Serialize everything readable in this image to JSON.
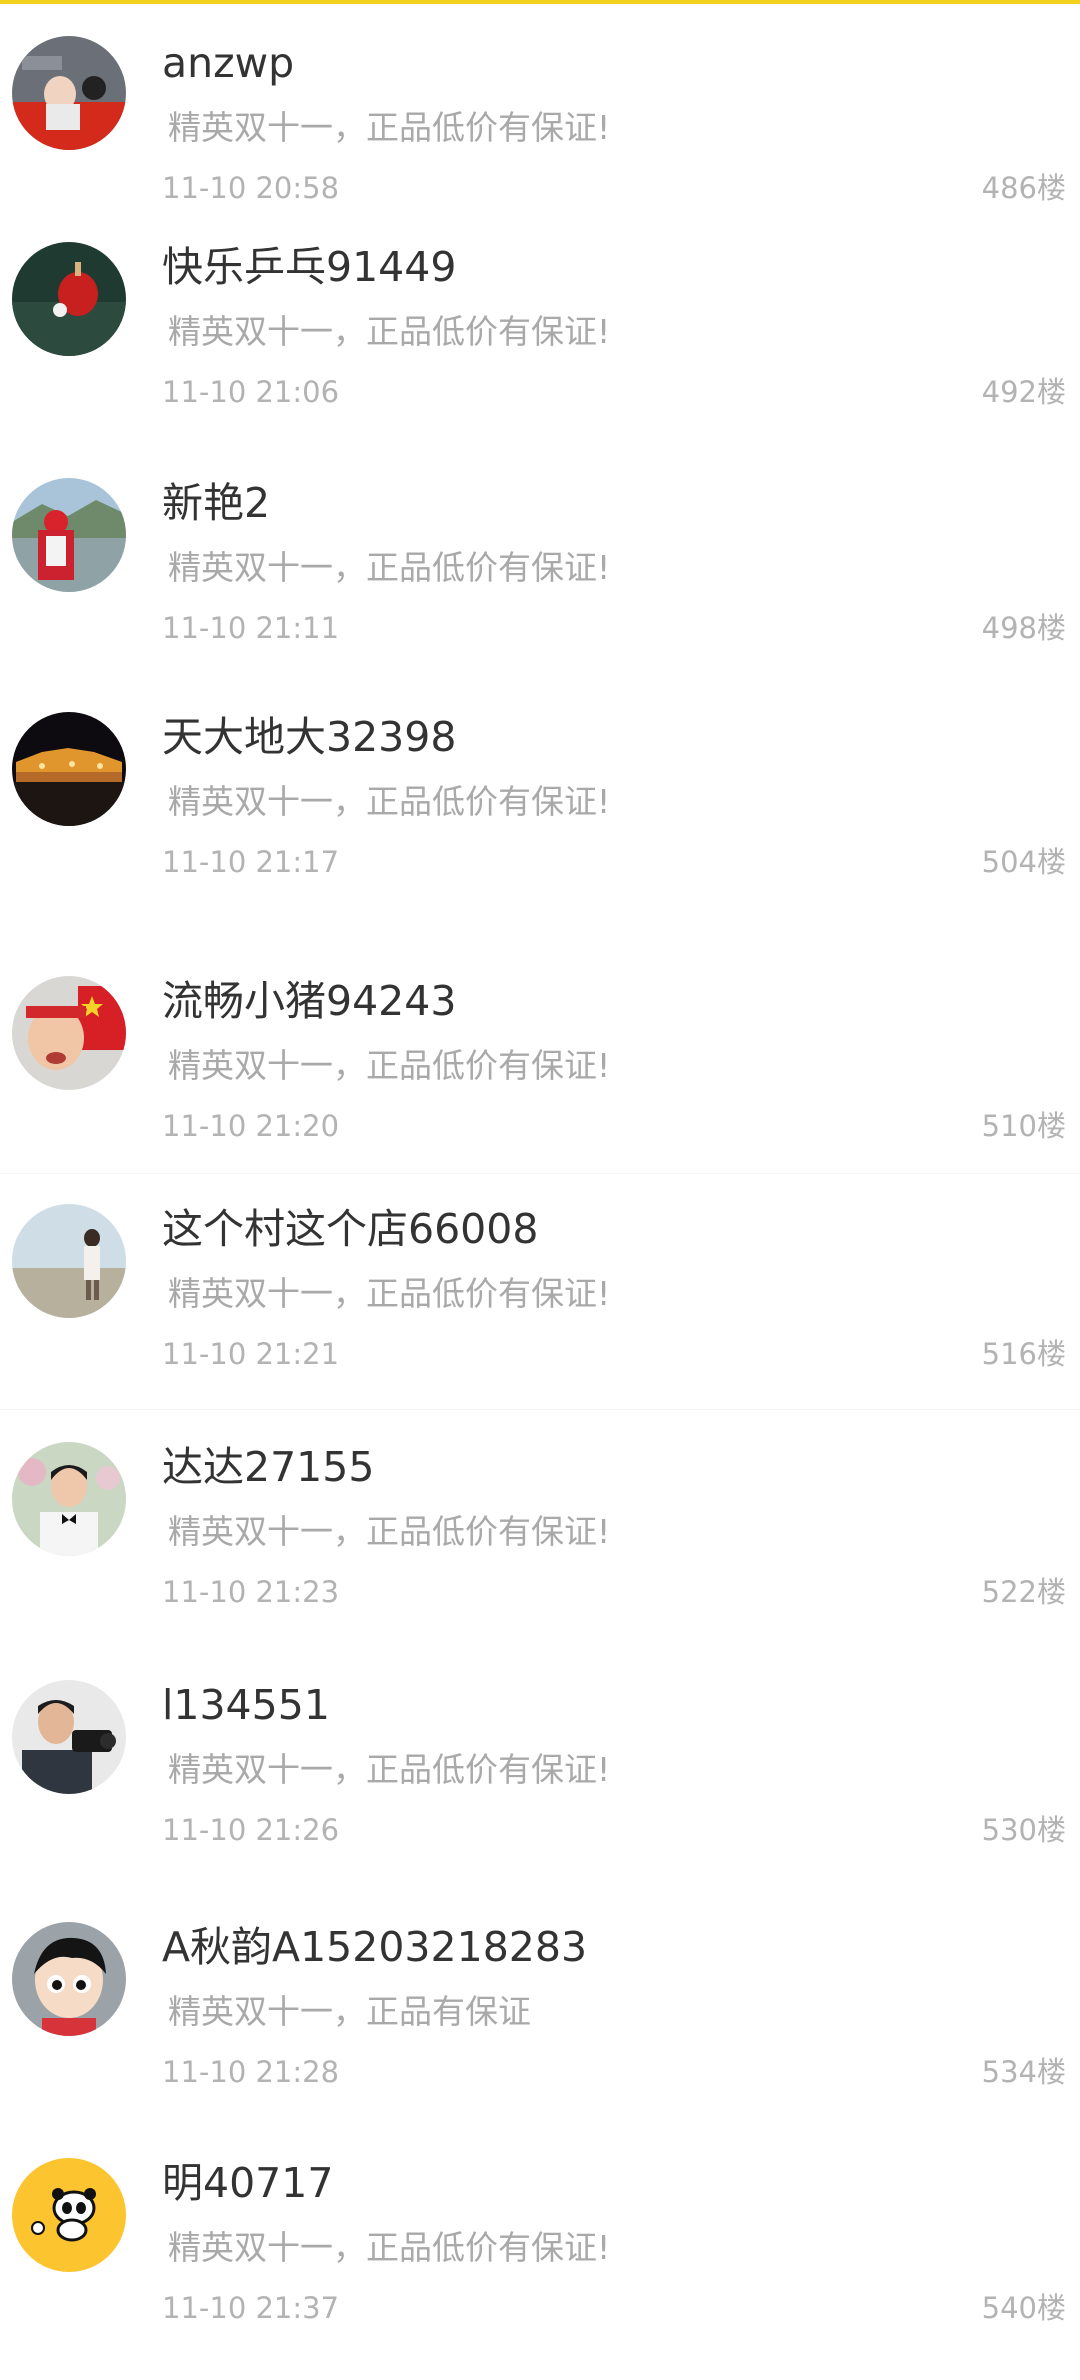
{
  "colors": {
    "accent": "#f2d21c",
    "username": "#333333",
    "message": "#a9a9a9",
    "meta": "#b3b3b3"
  },
  "comments": [
    {
      "username": "anzwp",
      "message": "精英双十一，正品低价有保证!",
      "time": "11-10 20:58",
      "floor": "486楼"
    },
    {
      "username": "快乐乒乓91449",
      "message": "精英双十一，正品低价有保证!",
      "time": "11-10 21:06",
      "floor": "492楼"
    },
    {
      "username": "新艳2",
      "message": "精英双十一，正品低价有保证!",
      "time": "11-10 21:11",
      "floor": "498楼"
    },
    {
      "username": "天大地大32398",
      "message": "精英双十一，正品低价有保证!",
      "time": "11-10 21:17",
      "floor": "504楼"
    },
    {
      "username": "流畅小猪94243",
      "message": "精英双十一，正品低价有保证!",
      "time": "11-10 21:20",
      "floor": "510楼"
    },
    {
      "username": "这个村这个店66008",
      "message": "精英双十一，正品低价有保证!",
      "time": "11-10 21:21",
      "floor": "516楼"
    },
    {
      "username": "达达27155",
      "message": "精英双十一，正品低价有保证!",
      "time": "11-10 21:23",
      "floor": "522楼"
    },
    {
      "username": "l134551",
      "message": "精英双十一，正品低价有保证!",
      "time": "11-10 21:26",
      "floor": "530楼"
    },
    {
      "username": "A秋韵A15203218283",
      "message": "精英双十一，正品有保证",
      "time": "11-10 21:28",
      "floor": "534楼"
    },
    {
      "username": "明40717",
      "message": "精英双十一，正品低价有保证!",
      "time": "11-10 21:37",
      "floor": "540楼"
    }
  ]
}
